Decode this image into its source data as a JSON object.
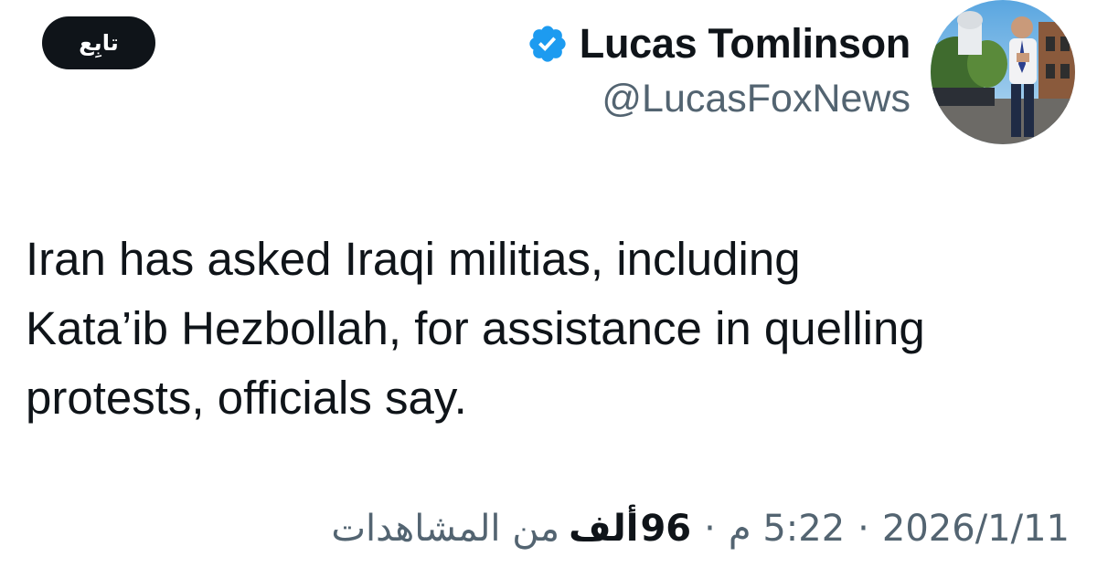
{
  "follow_button": {
    "label": "تابِع"
  },
  "author": {
    "display_name": "Lucas Tomlinson",
    "handle": "@LucasFoxNews",
    "verified_icon": "verified-badge-icon",
    "verified_color": "#1d9bf0",
    "avatar": "profile-photo"
  },
  "tweet": {
    "text": "Iran has asked Iraqi militias, including\nKata’ib Hezbollah, for assistance in quelling\nprotests, officials say."
  },
  "meta": {
    "date": "2026/1/11",
    "time": "5:22 م",
    "views_count": "96",
    "views_unit": "ألف",
    "views_label": "من المشاهدات",
    "separator": "·"
  },
  "colors": {
    "text_primary": "#0f1419",
    "text_secondary": "#536471",
    "follow_bg": "#0f1419",
    "follow_text": "#ffffff"
  }
}
